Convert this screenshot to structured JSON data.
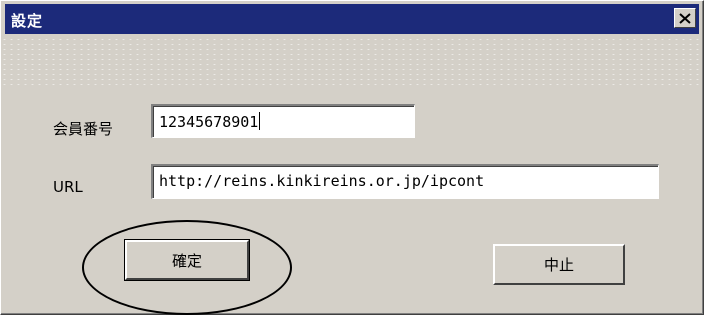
{
  "window": {
    "title": "設定",
    "close_icon": "close-icon"
  },
  "form": {
    "member_number": {
      "label": "会員番号",
      "value": "12345678901"
    },
    "url": {
      "label": "URL",
      "value": "http://reins.kinkireins.or.jp/ipcont"
    }
  },
  "buttons": {
    "confirm_label": "確定",
    "cancel_label": "中止"
  },
  "colors": {
    "title_bar": "#1c2a7a",
    "dialog_face": "#d4d0c8"
  }
}
